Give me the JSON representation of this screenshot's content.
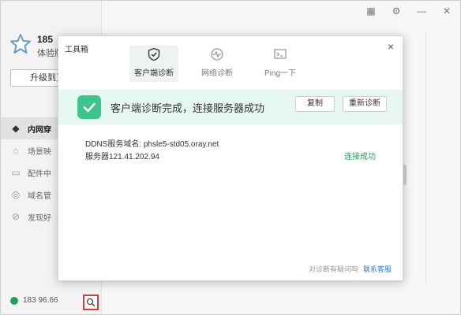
{
  "app": {
    "user_number": "185",
    "user_plan": "体验版",
    "upgrade_label": "升级到正",
    "nav": [
      {
        "label": "内网穿",
        "icon": "cube-icon",
        "active": true
      },
      {
        "label": "场景映",
        "icon": "home-icon",
        "active": false
      },
      {
        "label": "配件中",
        "icon": "device-icon",
        "active": false
      },
      {
        "label": "域名管",
        "icon": "globe-icon",
        "active": false
      },
      {
        "label": "发现好",
        "icon": "compass-icon",
        "active": false
      }
    ],
    "footer_account": "183     96.66"
  },
  "dialog": {
    "title": "工具箱",
    "close_symbol": "×",
    "tabs": [
      {
        "label": "客户端诊断",
        "active": true
      },
      {
        "label": "网络诊断",
        "active": false
      },
      {
        "label": "Ping一下",
        "active": false
      }
    ],
    "banner_message": "客户端诊断完成，连接服务器成功",
    "copy_label": "复制",
    "rediagnose_label": "重新诊断",
    "ddns_line": "DDNS服务域名: phsle5-std05.oray.net",
    "server_line": "服务器121.41.202.94",
    "status": "连接成功",
    "feedback_question": "对诊断有疑问吗",
    "contact_link": "联系客服"
  },
  "colors": {
    "accent_green": "#3cc48c",
    "status_green": "#22a05a",
    "link_blue": "#2b7bd6",
    "highlight_red": "#d43c3c"
  }
}
